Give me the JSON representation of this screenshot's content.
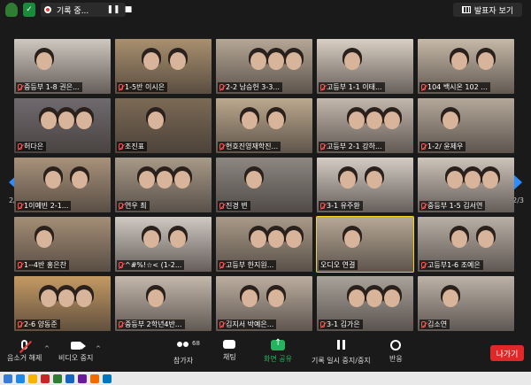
{
  "topbar": {
    "recording_label": "기록 중...",
    "view_label": "발표자 보기"
  },
  "nav": {
    "left_page": "2/3",
    "right_page": "2/3"
  },
  "participants": [
    {
      "name": "중등부 1-8 권은...",
      "bg": "#cfc8c0"
    },
    {
      "name": "1-5반 이시은",
      "bg": "#a9906e"
    },
    {
      "name": "2-2 남승헌 3-3...",
      "bg": "#b5a795"
    },
    {
      "name": "고등부 1-1 이태...",
      "bg": "#d9cfc4"
    },
    {
      "name": "104 백시온 102 ...",
      "bg": "#c6b9a8"
    },
    {
      "name": "허다은",
      "bg": "#6f6a6e"
    },
    {
      "name": "조진표",
      "bg": "#7b6a55"
    },
    {
      "name": "현호진영재학진...",
      "bg": "#bca98e"
    },
    {
      "name": "고등부 2-1 강하...",
      "bg": "#c3b8ad"
    },
    {
      "name": "1-2/ 윤제우",
      "bg": "#b4a89a"
    },
    {
      "name": "1이예빈 2-1...",
      "bg": "#a8927a"
    },
    {
      "name": "연우 최",
      "bg": "#a89a88"
    },
    {
      "name": "진경 변",
      "bg": "#8c8781"
    },
    {
      "name": "3-1 유주환",
      "bg": "#d4ccc4"
    },
    {
      "name": "중등부 1-5 김서연",
      "bg": "#cdc4ba"
    },
    {
      "name": "1--4반 홍은찬",
      "bg": "#a48e76"
    },
    {
      "name": "^#%!☆< (1-2...",
      "bg": "#cfc9c2"
    },
    {
      "name": "고등부 한지원...",
      "bg": "#a99a88"
    },
    {
      "name": "오디오 연결",
      "bg": "#b7a896"
    },
    {
      "name": "고등부1-6 조예은",
      "bg": "#b9b0a6"
    },
    {
      "name": "2-6 양동준",
      "bg": "#c49a63"
    },
    {
      "name": "중등부 2학년4반...",
      "bg": "#c4b8ac"
    },
    {
      "name": "김지서 박예은...",
      "bg": "#bcaea0"
    },
    {
      "name": "3-1 김가은",
      "bg": "#a9a39b"
    },
    {
      "name": "김소연",
      "bg": "#bcb2a8"
    }
  ],
  "toolbar": {
    "mute_label": "음소거 해제",
    "video_label": "비디오 중지",
    "participants_label": "참가자",
    "participants_count": "68",
    "chat_label": "채팅",
    "share_label": "화면 공유",
    "record_label": "기록 일시 중지/중지",
    "react_label": "반응",
    "leave_label": "나가기"
  }
}
